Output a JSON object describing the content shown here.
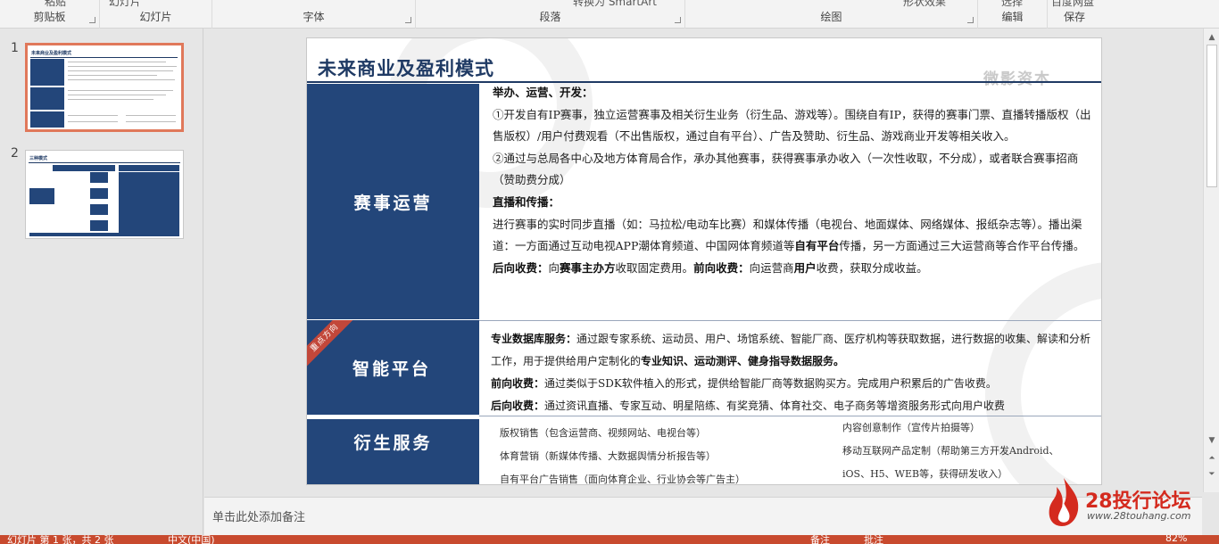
{
  "ribbon": {
    "groups": [
      {
        "label": "剪贴板",
        "cut": "粘贴"
      },
      {
        "label": "幻灯片",
        "cut": "幻灯片"
      },
      {
        "label": "字体",
        "cut": ""
      },
      {
        "label": "段落",
        "cut": "转换为 SmartArt"
      },
      {
        "label": "绘图",
        "cut": "形状效果"
      },
      {
        "label": "编辑",
        "cut": "选择"
      },
      {
        "label": "保存",
        "cut": "百度网盘"
      }
    ]
  },
  "thumbnails": [
    {
      "number": "1",
      "title": "未来商业及盈利模式"
    },
    {
      "number": "2",
      "title": "三种模式"
    }
  ],
  "slide": {
    "title": "未来商业及盈利模式",
    "watermark": "微影资本",
    "ribbon_tag": "重点方向",
    "sections": [
      {
        "label": "赛事运营"
      },
      {
        "label": "智能平台"
      },
      {
        "label": "衍生服务"
      }
    ],
    "s1": {
      "h1": "举办、运营、开发：",
      "p1": "①开发自有IP赛事，独立运营赛事及相关衍生业务（衍生品、游戏等）。围绕自有IP，获得的赛事门票、直播转播版权（出售版权）/用户付费观看（不出售版权，通过自有平台）、广告及赞助、衍生品、游戏商业开发等相关收入。",
      "p2": "②通过与总局各中心及地方体育局合作，承办其他赛事，获得赛事承办收入（一次性收取，不分成），或者联合赛事招商（赞助费分成）",
      "h2": "直播和传播：",
      "p3a": "进行赛事的实时同步直播（如：马拉松/电动车比赛）和媒体传播（电视台、地面媒体、网络媒体、报纸杂志等）。播出渠道：一方面通过互动电视APP潮体育频道、中国网体育频道等",
      "p3b": "自有平台",
      "p3c": "传播，另一方面通过三大运营商等合作平台传播。",
      "p4a": "后向收费：",
      "p4b": "向",
      "p4c": "赛事主办方",
      "p4d": "收取固定费用。",
      "p4e": "前向收费：",
      "p4f": "向运营商",
      "p4g": "用户",
      "p4h": "收费，获取分成收益。"
    },
    "s2": {
      "l1a": "专业数据库服务：",
      "l1b": "通过跟专家系统、运动员、用户、场馆系统、智能厂商、医疗机构等获取数据，进行数据的收集、解读和分析工作，用于提供给用户定制化的",
      "l1c": "专业知识、运动测评、健身指导数据服务。",
      "l2a": "前向收费：",
      "l2b": "通过类似于SDK软件植入的形式，提供给智能厂商等数据购买方。完成用户积累后的广告收费。",
      "l3a": "后向收费：",
      "l3b": "通过资讯直播、专家互动、明星陪练、有奖竞猜、体育社交、电子商务等增资服务形式向用户收费"
    },
    "s3": {
      "left": [
        "版权销售（包含运营商、视频网站、电视台等）",
        "体育营销（新媒体传播、大数据舆情分析报告等）",
        "自有平台广告销售（面向体育企业、行业协会等广告主）"
      ],
      "right": [
        "内容创意制作（宣传片拍摄等）",
        "移动互联网产品定制（帮助第三方开发Android、",
        "iOS、H5、WEB等，获得研发收入）"
      ]
    }
  },
  "notes": {
    "placeholder": "单击此处添加备注"
  },
  "status": {
    "slide_info": "幻灯片 第 1 张，共 2 张",
    "language": "中文(中国)",
    "notes_btn": "备注",
    "comments_btn": "批注",
    "zoom": "82%"
  },
  "logo": {
    "text": "28投行论坛",
    "url": "www.28touhang.com"
  },
  "colors": {
    "navy": "#23467a",
    "accent": "#c84a2e"
  }
}
